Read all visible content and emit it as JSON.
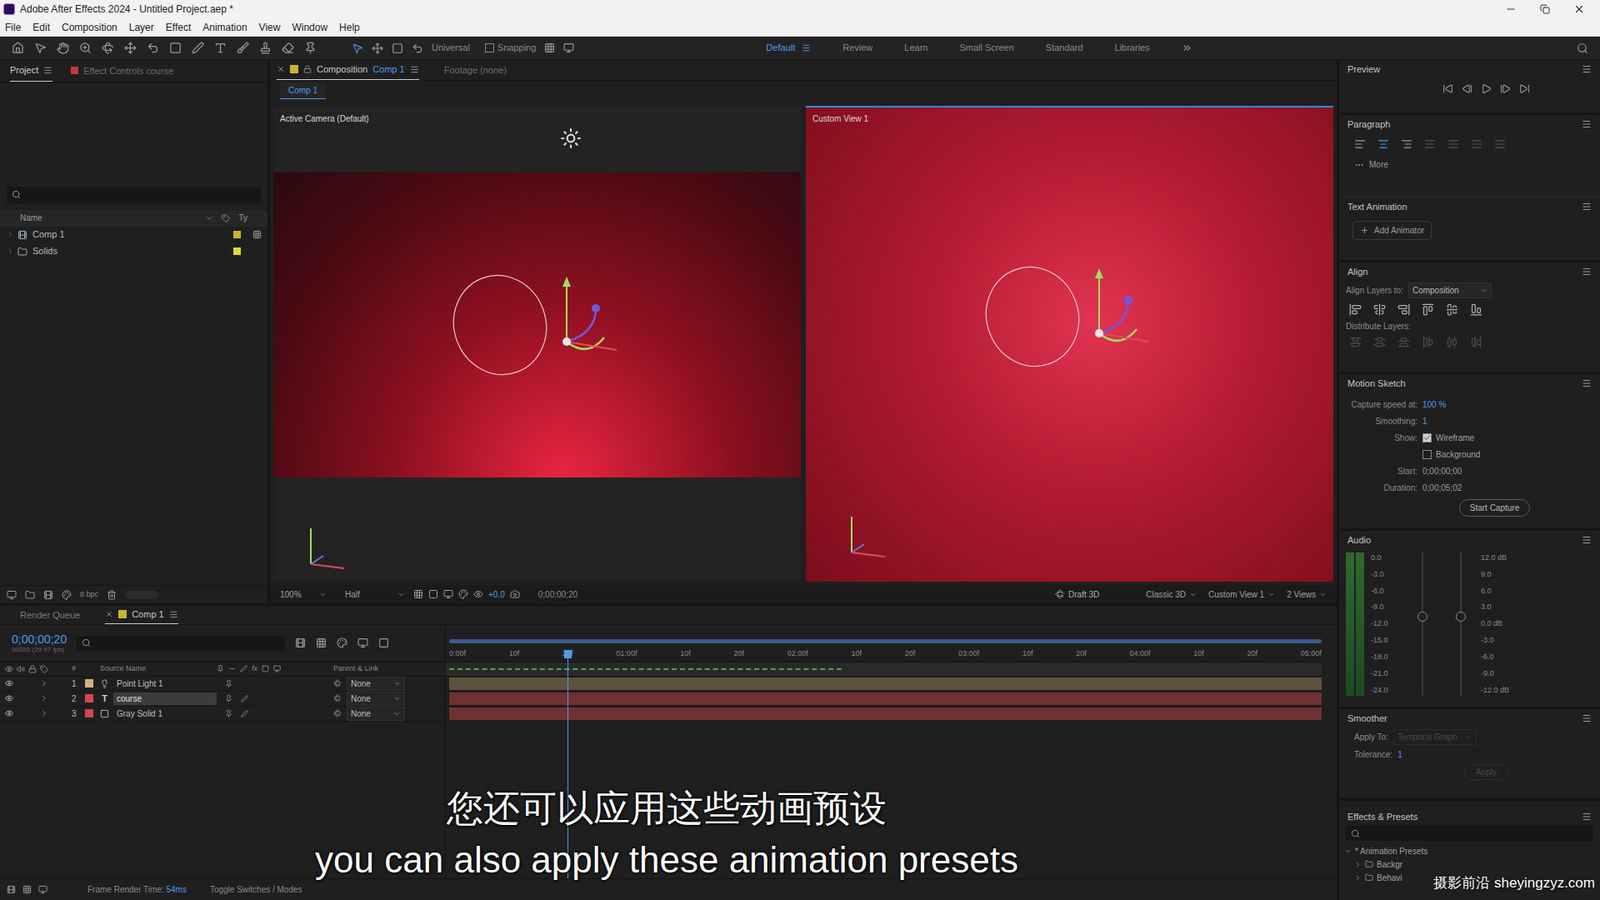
{
  "window": {
    "title": "Adobe After Effects 2024 - Untitled Project.aep *"
  },
  "menu": [
    "File",
    "Edit",
    "Composition",
    "Layer",
    "Effect",
    "Animation",
    "View",
    "Window",
    "Help"
  ],
  "toolbar": {
    "axis_mode": "Universal",
    "snapping": {
      "label": "Snapping",
      "checked": false
    },
    "workspaces": [
      {
        "label": "Default",
        "selected": true
      },
      {
        "label": "Review",
        "selected": false
      },
      {
        "label": "Learn",
        "selected": false
      },
      {
        "label": "Small Screen",
        "selected": false
      },
      {
        "label": "Standard",
        "selected": false
      },
      {
        "label": "Libraries",
        "selected": false
      }
    ]
  },
  "project_panel": {
    "tabs": [
      {
        "label": "Project",
        "selected": true
      },
      {
        "label": "Effect Controls course",
        "selected": false
      }
    ],
    "columns": [
      "Name",
      "Ty"
    ],
    "items": [
      {
        "name": "Comp 1",
        "kind": "comp",
        "color": "#c9b430"
      },
      {
        "name": "Solids",
        "kind": "folder",
        "color": "#e2d83a"
      }
    ],
    "bit_depth": "8 bpc"
  },
  "composition": {
    "tabs": [
      {
        "label": "Composition",
        "comp": "Comp 1",
        "selected": true
      },
      {
        "label": "Footage (none)",
        "comp": "",
        "selected": false
      }
    ],
    "subtab": "Comp 1",
    "views": [
      {
        "label": "Active Camera (Default)",
        "selected": false
      },
      {
        "label": "Custom View 1",
        "selected": true
      }
    ],
    "bottom_bar": {
      "zoom": "100%",
      "resolution": "Half",
      "exposure": "+0.0",
      "time": "0;00;00;20",
      "renderer_mode": "Draft 3D",
      "renderer": "Classic 3D",
      "view": "Custom View 1",
      "layout": "2 Views"
    }
  },
  "preview": {
    "title": "Preview"
  },
  "paragraph": {
    "title": "Paragraph",
    "more": "More"
  },
  "text_animation": {
    "title": "Text Animation",
    "button": "Add Animator"
  },
  "align": {
    "title": "Align",
    "align_to_label": "Align Layers to:",
    "align_to": "Composition",
    "distribute_label": "Distribute Layers:"
  },
  "motion_sketch": {
    "title": "Motion Sketch",
    "fields": [
      {
        "label": "Capture speed at:",
        "value": "100 %"
      },
      {
        "label": "Smoothing:",
        "value": "1"
      }
    ],
    "show_label": "Show:",
    "options": [
      {
        "label": "Wireframe",
        "checked": true
      },
      {
        "label": "Background",
        "checked": false
      }
    ],
    "times": [
      {
        "label": "Start:",
        "value": "0;00;00;00"
      },
      {
        "label": "Duration:",
        "value": "0;00;05;02"
      }
    ],
    "button": "Start Capture"
  },
  "audio": {
    "title": "Audio",
    "left_scale": [
      "0.0",
      "-3.0",
      "-6.0",
      "-9.0",
      "-12.0",
      "-15.0",
      "-18.0",
      "-21.0",
      "-24.0"
    ],
    "right_scale": [
      "12.0 dB",
      "9.0",
      "6.0",
      "3.0",
      "0.0 dB",
      "-3.0",
      "-6.0",
      "-9.0",
      "-12.0 dB"
    ],
    "channels": [
      {
        "level": 1
      },
      {
        "level": 1
      }
    ],
    "sliders": [
      {
        "level": 0.55
      },
      {
        "level": 0.55
      }
    ]
  },
  "smoother": {
    "title": "Smoother",
    "apply_to_label": "Apply To:",
    "apply_to": {
      "value": "Temporal Graph",
      "disabled": true
    },
    "tolerance_label": "Tolerance:",
    "tolerance": "1",
    "button": {
      "label": "Apply",
      "disabled": true
    }
  },
  "effects_presets": {
    "title": "Effects & Presets",
    "tree": [
      {
        "label": "* Animation Presets",
        "expanded": true,
        "depth": 0
      },
      {
        "label": "Backgr",
        "expanded": false,
        "depth": 1
      },
      {
        "label": "Behavi",
        "expanded": false,
        "depth": 1
      }
    ]
  },
  "timeline": {
    "tabs": [
      {
        "label": "Render Queue",
        "selected": false
      },
      {
        "label": "Comp 1",
        "selected": true
      }
    ],
    "time": "0;00;00;20",
    "fps": "00020 (29.97 fps)",
    "columns": [
      "#",
      "Source Name",
      "Parent & Link"
    ],
    "layers": [
      {
        "index": "1",
        "name": "Point Light 1",
        "kind": "light",
        "color": "#d6b07c",
        "selected": false,
        "parent": "None"
      },
      {
        "index": "2",
        "name": "course",
        "kind": "text",
        "type_glyph": "T",
        "color": "#d14848",
        "selected": true,
        "parent": "None"
      },
      {
        "index": "3",
        "name": "Gray Solid 1",
        "kind": "solid",
        "color": "#d14848",
        "selected": false,
        "parent": "None"
      }
    ],
    "ruler": [
      "0:00f",
      "10f",
      "20f",
      "01:00f",
      "10f",
      "20f",
      "02:00f",
      "10f",
      "20f",
      "03:00f",
      "10f",
      "20f",
      "04:00f",
      "10f",
      "20f",
      "05:00f"
    ],
    "playhead": 0.133
  },
  "status_bar": {
    "frame_render_label": "Frame Render Time:",
    "frame_render_value": "54ms",
    "toggle": "Toggle Switches / Modes"
  },
  "subtitles": [
    "您还可以应用这些动画预设",
    "you can also apply these animation presets"
  ],
  "watermark": "摄影前沿 sheyingzyz.com"
}
